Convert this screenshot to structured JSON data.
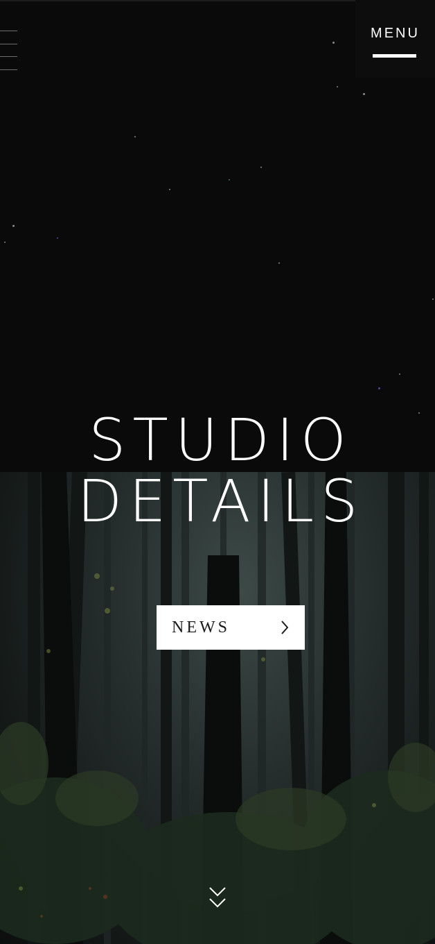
{
  "header": {
    "menu_label": "MENU"
  },
  "hero": {
    "logo_line1": "STUDIO",
    "logo_line2": "DETAILS"
  },
  "cta": {
    "news_label": "NEWS",
    "arrow_icon": "chevron-right-icon"
  },
  "footer": {
    "scroll_icon": "double-chevron-down-icon"
  },
  "colors": {
    "background": "#0a0a0a",
    "text": "#ffffff",
    "button_bg": "#ffffff",
    "button_text": "#1a1a1a"
  }
}
